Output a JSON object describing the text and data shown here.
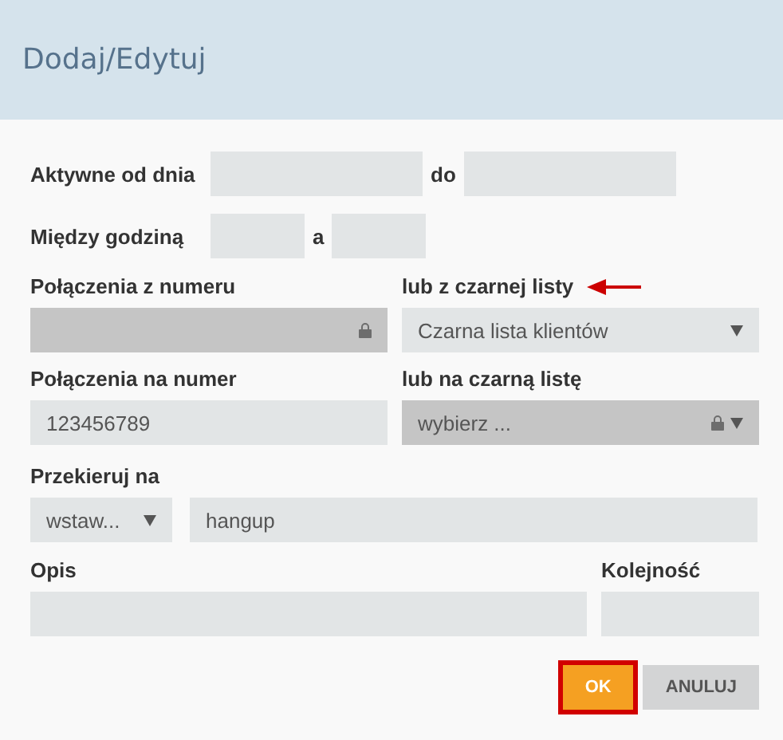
{
  "dialog": {
    "title": "Dodaj/Edytuj"
  },
  "date_range": {
    "label": "Aktywne od dnia",
    "separator": "do"
  },
  "time_range": {
    "label": "Między godziną",
    "separator": "a"
  },
  "from_number": {
    "label": "Połączenia z numeru",
    "locked": true
  },
  "from_blacklist": {
    "label": "lub z czarnej listy",
    "value": "Czarna lista klientów",
    "locked": false,
    "annotated": true
  },
  "to_number": {
    "label": "Połączenia na numer",
    "value": "123456789",
    "locked": false
  },
  "to_blacklist": {
    "label": "lub na czarną listę",
    "value": "wybierz ...",
    "locked": true
  },
  "redirect": {
    "label": "Przekieruj na",
    "select": "wstaw...",
    "value": "hangup"
  },
  "description": {
    "label": "Opis"
  },
  "order": {
    "label": "Kolejność"
  },
  "buttons": [
    {
      "label": "OK",
      "kind": "primary",
      "highlighted": true
    },
    {
      "label": "ANULUJ",
      "kind": "secondary",
      "highlighted": false
    }
  ]
}
